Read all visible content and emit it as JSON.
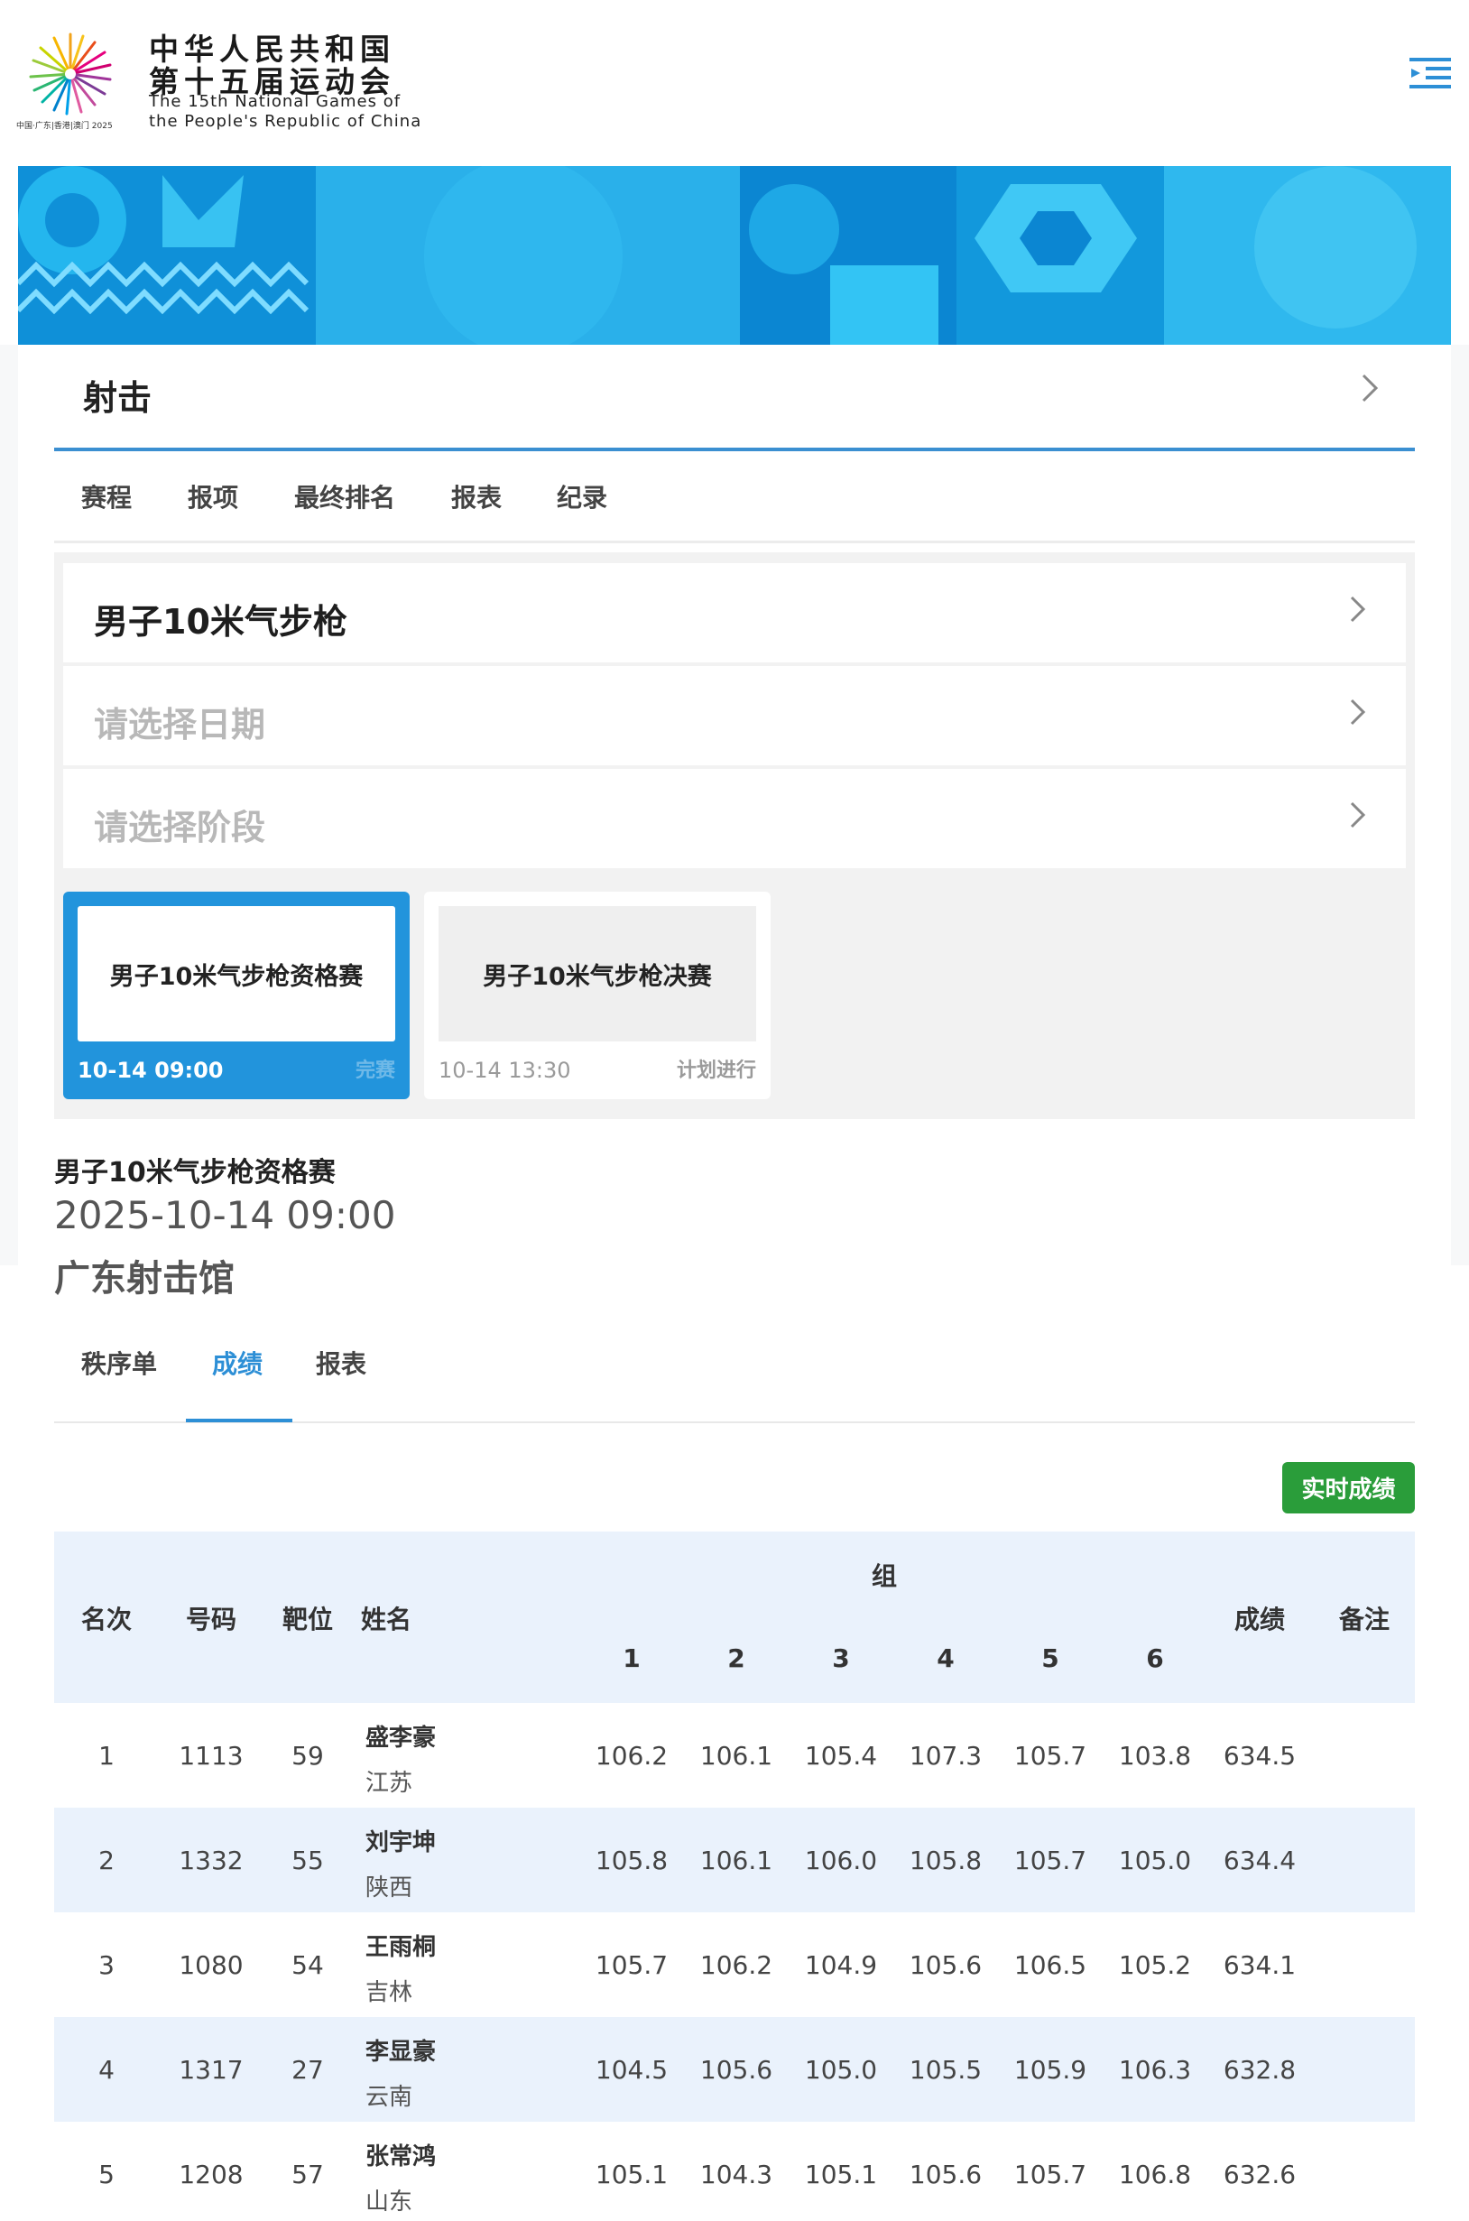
{
  "header": {
    "title_line1": "中华人民共和国",
    "title_line2": "第十五届运动会",
    "title_en_line1": "The 15th National Games of",
    "title_en_line2": "the People's Republic of China",
    "logo_caption": "中国·广东|香港|澳门 2025",
    "menu_icon": "menu-indent-icon"
  },
  "sport": {
    "title": "射击"
  },
  "subnav": [
    "赛程",
    "报项",
    "最终排名",
    "报表",
    "纪录"
  ],
  "filters": {
    "event": "男子10米气步枪",
    "date_placeholder": "请选择日期",
    "phase_placeholder": "请选择阶段"
  },
  "phases": [
    {
      "name": "男子10米气步枪资格赛",
      "time": "10-14 09:00",
      "status": "完赛"
    },
    {
      "name": "男子10米气步枪决赛",
      "time": "10-14 13:30",
      "status": "计划进行"
    }
  ],
  "event": {
    "title": "男子10米气步枪资格赛",
    "datetime": "2025-10-14 09:00",
    "venue": "广东射击馆"
  },
  "tabs": [
    "秩序单",
    "成绩",
    "报表"
  ],
  "active_tab": "成绩",
  "live_button": "实时成绩",
  "table": {
    "headers": {
      "rank": "名次",
      "bib": "号码",
      "lane": "靶位",
      "name": "姓名",
      "group": "组",
      "g1": "1",
      "g2": "2",
      "g3": "3",
      "g4": "4",
      "g5": "5",
      "g6": "6",
      "total": "成绩",
      "remark": "备注"
    },
    "rows": [
      {
        "rank": "1",
        "bib": "1113",
        "lane": "59",
        "name": "盛李豪",
        "prov": "江苏",
        "s1": "106.2",
        "s2": "106.1",
        "s3": "105.4",
        "s4": "107.3",
        "s5": "105.7",
        "s6": "103.8",
        "total": "634.5",
        "remark": ""
      },
      {
        "rank": "2",
        "bib": "1332",
        "lane": "55",
        "name": "刘宇坤",
        "prov": "陕西",
        "s1": "105.8",
        "s2": "106.1",
        "s3": "106.0",
        "s4": "105.8",
        "s5": "105.7",
        "s6": "105.0",
        "total": "634.4",
        "remark": ""
      },
      {
        "rank": "3",
        "bib": "1080",
        "lane": "54",
        "name": "王雨桐",
        "prov": "吉林",
        "s1": "105.7",
        "s2": "106.2",
        "s3": "104.9",
        "s4": "105.6",
        "s5": "106.5",
        "s6": "105.2",
        "total": "634.1",
        "remark": ""
      },
      {
        "rank": "4",
        "bib": "1317",
        "lane": "27",
        "name": "李显豪",
        "prov": "云南",
        "s1": "104.5",
        "s2": "105.6",
        "s3": "105.0",
        "s4": "105.5",
        "s5": "105.9",
        "s6": "106.3",
        "total": "632.8",
        "remark": ""
      },
      {
        "rank": "5",
        "bib": "1208",
        "lane": "57",
        "name": "张常鸿",
        "prov": "山东",
        "s1": "105.1",
        "s2": "104.3",
        "s3": "105.1",
        "s4": "105.6",
        "s5": "105.7",
        "s6": "106.8",
        "total": "632.6",
        "remark": ""
      }
    ]
  },
  "colors": {
    "accent_blue": "#2294dc",
    "tab_active": "#2d8fd6",
    "live_green": "#2a9d3a",
    "row_alt": "#eaf2fc"
  }
}
